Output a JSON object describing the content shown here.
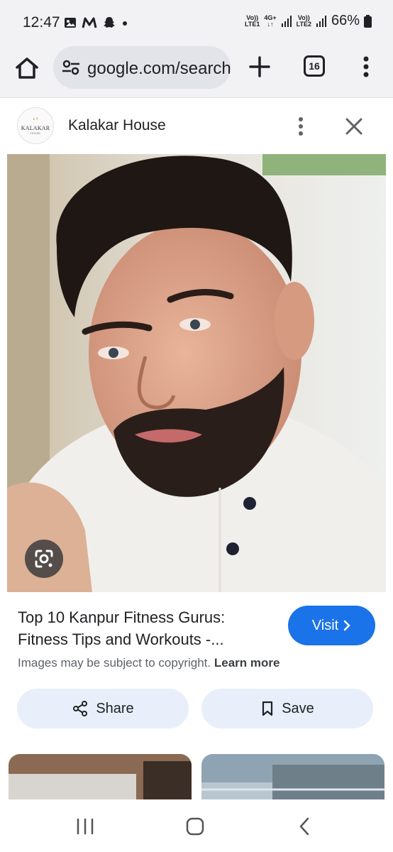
{
  "status_bar": {
    "time": "12:47",
    "notification_icons": [
      "gallery-icon",
      "m-app-icon",
      "snapchat-icon",
      "dot-icon"
    ],
    "sim1_label_top": "Vo))",
    "sim1_label_bottom": "LTE1",
    "network_type_top": "4G+",
    "network_type_bottom": "↓↑",
    "sim2_label_top": "Vo))",
    "sim2_label_bottom": "LTE2",
    "battery": "66%"
  },
  "toolbar": {
    "url": "google.com/search",
    "tab_count": "16",
    "icons": [
      "home-icon",
      "tune-icon",
      "plus-icon",
      "tabs-icon",
      "more-vert-icon"
    ]
  },
  "source": {
    "name": "Kalakar House",
    "logo_mark": "‘’",
    "logo_text": "KALAKAR",
    "logo_subtext": "HOUSE"
  },
  "result": {
    "title": "Top 10 Kanpur Fitness Gurus: Fitness Tips and Workouts -...",
    "visit_label": "Visit",
    "copyright_text": "Images may be subject to copyright.",
    "learn_more_label": "Learn more",
    "share_label": "Share",
    "save_label": "Save"
  },
  "colors": {
    "accent": "#1a73e8",
    "chip_background": "#e8effa",
    "toolbar_background": "#f2f2f4"
  }
}
